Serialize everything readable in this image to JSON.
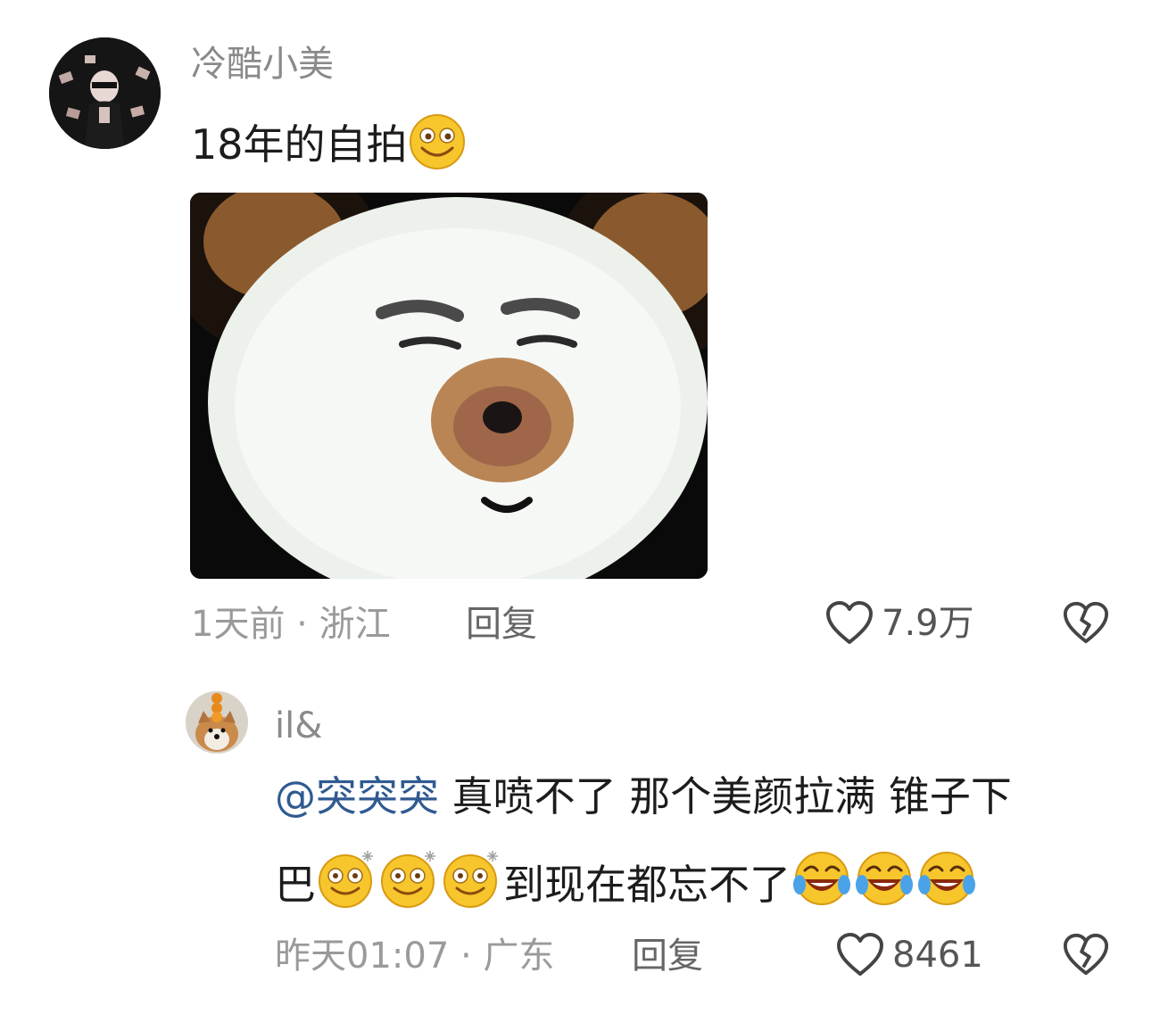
{
  "comment": {
    "username": "冷酷小美",
    "text": "18年的自拍",
    "emoji": "smile-emoji",
    "image_alt": "panda-meme-image",
    "time": "1天前",
    "separator": "·",
    "location": "浙江",
    "reply_label": "回复",
    "like_count": "7.9万"
  },
  "reply": {
    "username": "il&",
    "mention": "@突突突",
    "text_line1": " 真喷不了 那个美颜拉满 锥子下",
    "text_line2_prefix": "巴",
    "text_line2_suffix": "到现在都忘不了",
    "time": "昨天01:07",
    "separator": "·",
    "location": "广东",
    "reply_label": "回复",
    "like_count": "8461"
  },
  "colors": {
    "mention": "#2f5a91",
    "emoji_yellow": "#f7c62c"
  }
}
